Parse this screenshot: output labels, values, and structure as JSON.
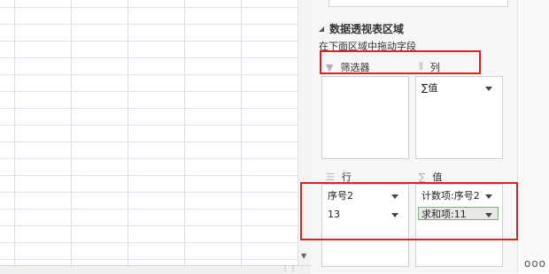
{
  "pivot": {
    "section_title": "数据透视表区域",
    "hint": "在下面区域中拖动字段",
    "zones": {
      "filter": {
        "label": "筛选器",
        "icon": "filter-icon"
      },
      "columns": {
        "label": "列",
        "icon": "columns-icon",
        "fields": [
          "∑值"
        ]
      },
      "rows": {
        "label": "行",
        "icon": "rows-icon",
        "fields": [
          "序号2",
          "13"
        ]
      },
      "values": {
        "label": "值",
        "icon": "sigma-icon",
        "fields": [
          "计数项:序号2",
          "求和项:11"
        ]
      }
    }
  },
  "more_label": "ooo",
  "highlight_color": "#e32020"
}
